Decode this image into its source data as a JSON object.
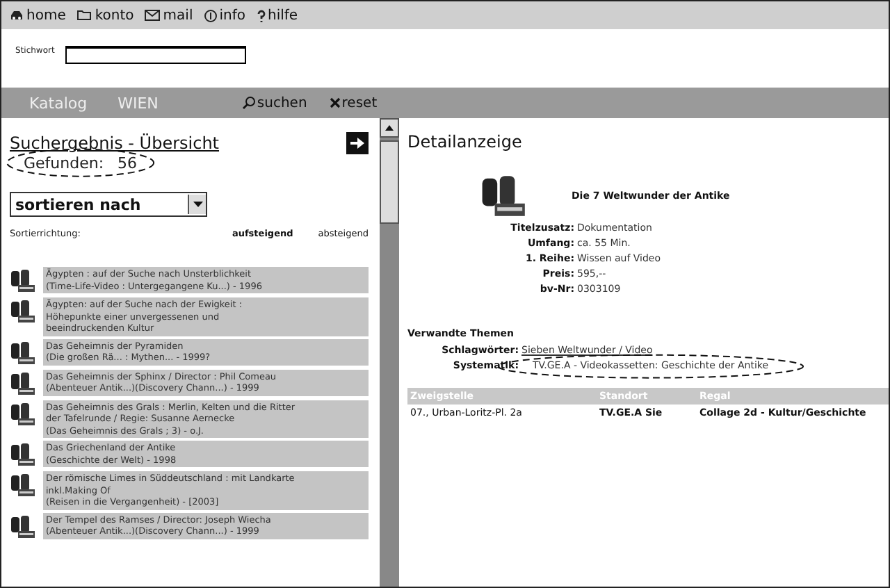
{
  "top_nav": [
    {
      "kind": "home",
      "label": "home"
    },
    {
      "kind": "folder",
      "label": "konto"
    },
    {
      "kind": "mail",
      "label": "mail"
    },
    {
      "kind": "info",
      "label": "info"
    },
    {
      "kind": "help",
      "label": "hilfe"
    }
  ],
  "search": {
    "label": "Stichwort"
  },
  "toolbar": {
    "catalog": "Katalog",
    "location": "WIEN",
    "search_button": "suchen",
    "reset_button": "reset"
  },
  "results": {
    "title": "Suchergebnis - Übersicht",
    "found_label": "Gefunden:",
    "found_count": "56",
    "sort_select": "sortieren nach",
    "sort_direction_label": "Sortierrichtung:",
    "sort_options": [
      {
        "label": "aufsteigend",
        "selected": true
      },
      {
        "label": "absteigend",
        "selected": false
      }
    ],
    "items": [
      {
        "lines": [
          "Ägypten : auf der Suche nach Unsterblichkeit",
          "(Time-Life-Video : Untergegangene Ku...) - 1996"
        ]
      },
      {
        "lines": [
          "Ägypten: auf der Suche nach der Ewigkeit :",
          "Höhepunkte einer unvergessenen und",
          "beeindruckenden Kultur"
        ]
      },
      {
        "lines": [
          "Das Geheimnis der Pyramiden",
          "(Die großen Rä... : Mythen... - 1999?"
        ]
      },
      {
        "lines": [
          "Das Geheimnis der Sphinx / Director : Phil Comeau",
          "(Abenteuer Antik...)(Discovery Chann...) - 1999"
        ]
      },
      {
        "lines": [
          "Das Geheimnis des Grals : Merlin, Kelten und die Ritter",
          "der Tafelrunde / Regie: Susanne Aernecke",
          "(Das Geheimnis des Grals ; 3) - o.J."
        ]
      },
      {
        "lines": [
          "Das Griechenland der Antike",
          "(Geschichte der Welt) - 1998"
        ]
      },
      {
        "lines": [
          "Der römische Limes in Süddeutschland : mit Landkarte",
          "inkl.Making Of",
          "(Reisen in die Vergangenheit) - [2003]"
        ]
      },
      {
        "lines": [
          "Der Tempel des Ramses / Director: Joseph Wiecha",
          "(Abenteuer Antik...)(Discovery Chann...) - 1999"
        ]
      }
    ]
  },
  "detail": {
    "title": "Detailanzeige",
    "item_title": "Die 7 Weltwunder der Antike",
    "fields": [
      {
        "label": "Titelzusatz:",
        "value": "Dokumentation"
      },
      {
        "label": "Umfang:",
        "value": "ca. 55 Min."
      },
      {
        "label": "1. Reihe:",
        "value": "Wissen auf Video"
      },
      {
        "label": "Preis:",
        "value": "595,--"
      },
      {
        "label": "bv-Nr:",
        "value": "0303109"
      }
    ],
    "related_title": "Verwandte Themen",
    "related": [
      {
        "label": "Schlagwörter:",
        "value": "Sieben Weltwunder / Video",
        "kind": "link"
      },
      {
        "label": "Systematik:",
        "value": "TV.GE.A  - Videokassetten: Geschichte der Antike",
        "kind": "text"
      }
    ],
    "holdings": {
      "columns": [
        "Zweigstelle",
        "Standort",
        "Regal"
      ],
      "rows": [
        [
          "07., Urban-Loritz-Pl. 2a",
          "TV.GE.A Sie",
          "Collage 2d - Kultur/Geschichte"
        ]
      ]
    }
  }
}
